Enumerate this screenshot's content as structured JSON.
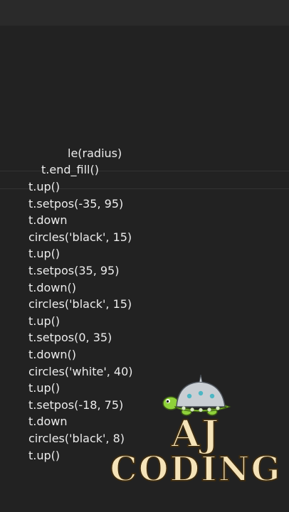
{
  "code_lines": [
    "le(radius)",
    "t.end_fill()",
    "t.up()",
    "t.setpos(-35, 95)",
    "t.down",
    "circles('black', 15)",
    "t.up()",
    "t.setpos(35, 95)",
    "t.down()",
    "circles('black', 15)",
    "t.up()",
    "t.setpos(0, 35)",
    "t.down()",
    "circles('white', 40)",
    "t.up()",
    "t.setpos(-18, 75)",
    "t.down",
    "circles('black', 8)",
    "t.up()"
  ],
  "logo": {
    "line1": "AJ",
    "line2": "CODING",
    "mascot_icon": "turtle-icon"
  },
  "colors": {
    "background": "#222222",
    "code_text": "#ececec",
    "logo_fill": "#f5e3b8",
    "logo_outline": "#3a2a10",
    "turtle_shell": "#c9ced3",
    "turtle_body": "#8fd13a"
  }
}
